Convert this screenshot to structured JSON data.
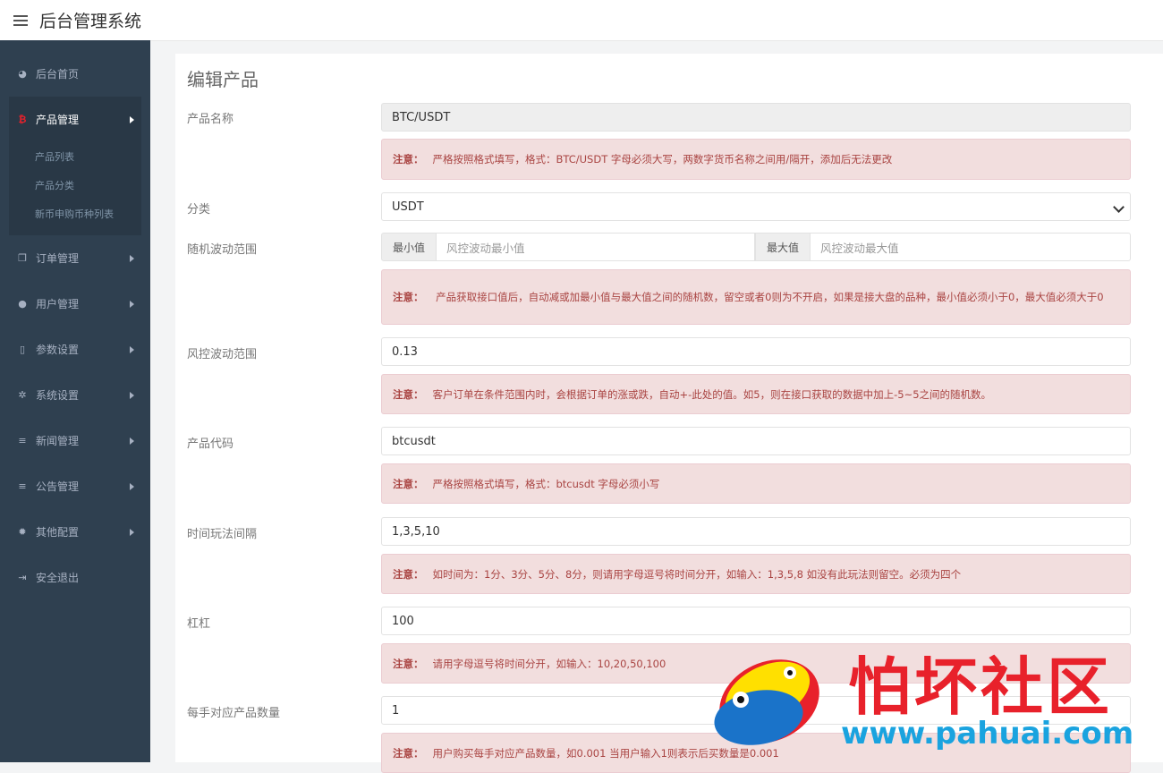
{
  "app": {
    "title": "后台管理系统"
  },
  "sidebar": {
    "items": [
      {
        "label": "后台首页",
        "icon": "dashboard-icon"
      },
      {
        "label": "产品管理",
        "icon": "bitcoin-icon",
        "active": true,
        "children": [
          "产品列表",
          "产品分类",
          "新币申购币种列表"
        ]
      },
      {
        "label": "订单管理",
        "icon": "copy-icon"
      },
      {
        "label": "用户管理",
        "icon": "user-icon"
      },
      {
        "label": "参数设置",
        "icon": "file-icon"
      },
      {
        "label": "系统设置",
        "icon": "cogs-icon"
      },
      {
        "label": "新闻管理",
        "icon": "bars-icon"
      },
      {
        "label": "公告管理",
        "icon": "bars-icon"
      },
      {
        "label": "其他配置",
        "icon": "cog-icon"
      },
      {
        "label": "安全退出",
        "icon": "sign-out-icon"
      }
    ]
  },
  "form": {
    "title": "编辑产品",
    "name": {
      "label": "产品名称",
      "value": "BTC/USDT",
      "note_prefix": "注意：",
      "note": "严格按照格式填写，格式：BTC/USDT 字母必须大写，两数字货币名称之间用/隔开，添加后无法更改"
    },
    "category": {
      "label": "分类",
      "value": "USDT"
    },
    "random_range": {
      "label": "随机波动范围",
      "min_addon": "最小值",
      "min_placeholder": "风控波动最小值",
      "max_addon": "最大值",
      "max_placeholder": "风控波动最大值",
      "note_prefix": "注意：",
      "note": "产品获取接口值后，自动减或加最小值与最大值之间的随机数，留空或者0则为不开启，如果是接大盘的品种，最小值必须小于0，最大值必须大于0"
    },
    "risk_range": {
      "label": "风控波动范围",
      "value": "0.13",
      "note_prefix": "注意：",
      "note": "客户订单在条件范围内时，会根据订单的涨或跌，自动+-此处的值。如5，则在接口获取的数据中加上-5~5之间的随机数。"
    },
    "code": {
      "label": "产品代码",
      "value": "btcusdt",
      "note_prefix": "注意：",
      "note": "严格按照格式填写，格式：btcusdt 字母必须小写"
    },
    "interval": {
      "label": "时间玩法间隔",
      "value": "1,3,5,10",
      "note_prefix": "注意：",
      "note": "如时间为：1分、3分、5分、8分，则请用字母逗号将时间分开，如输入：1,3,5,8 如没有此玩法则留空。必须为四个"
    },
    "leverage": {
      "label": "杠杠",
      "value": "100",
      "note_prefix": "注意：",
      "note": "请用字母逗号将时间分开，如输入：10,20,50,100"
    },
    "lot": {
      "label": "每手对应产品数量",
      "value": "1",
      "note_prefix": "注意：",
      "note": "用户购买每手对应产品数量，如0.001 当用户输入1则表示后买数量是0.001"
    }
  },
  "watermark": {
    "text": "怕坏社区",
    "url": "www.pahuai.com"
  },
  "colors": {
    "sidebar": "#2f4050",
    "note_bg": "#f2dede",
    "note_text": "#a94442",
    "watermark_red": "#e8212b",
    "watermark_blue": "#1aa3df"
  }
}
